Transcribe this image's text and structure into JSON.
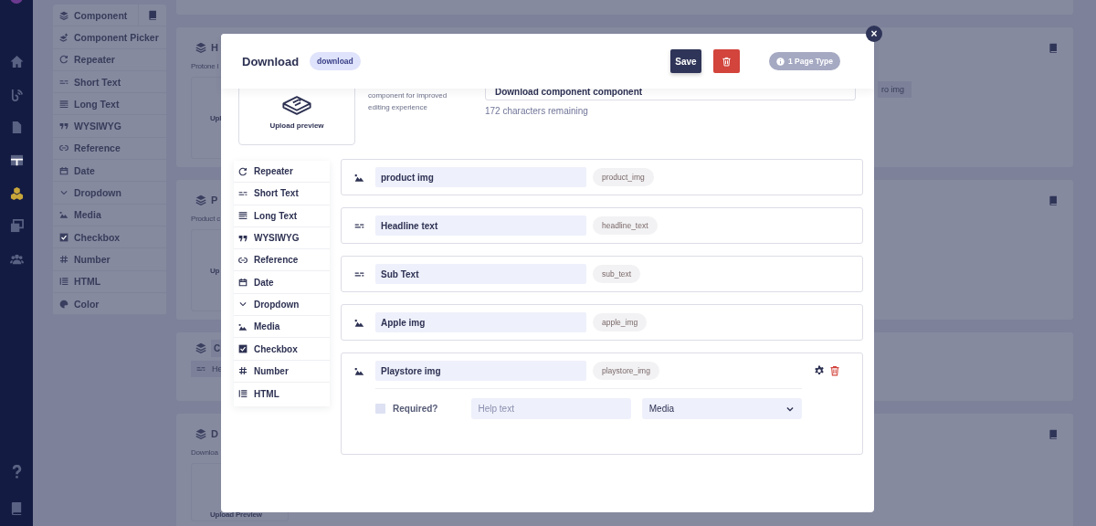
{
  "nav": [
    {
      "kind": "home",
      "selected": false
    },
    {
      "kind": "feed",
      "selected": false
    },
    {
      "kind": "document",
      "selected": false
    },
    {
      "kind": "grid",
      "selected": false
    },
    {
      "kind": "cubes",
      "selected": true
    },
    {
      "kind": "images",
      "selected": false
    },
    {
      "kind": "users",
      "selected": false
    }
  ],
  "nav_bottom": [
    {
      "kind": "help"
    },
    {
      "kind": "book"
    }
  ],
  "field_types": [
    {
      "kind": "component",
      "label": "Component",
      "docs": true
    },
    {
      "kind": "component_picker",
      "label": "Component Picker",
      "docs": false
    },
    {
      "kind": "repeater",
      "label": "Repeater",
      "docs": false
    },
    {
      "kind": "short_text",
      "label": "Short Text",
      "docs": false
    },
    {
      "kind": "long_text",
      "label": "Long Text",
      "docs": false
    },
    {
      "kind": "wysiwyg",
      "label": "WYSIWYG",
      "docs": false
    },
    {
      "kind": "reference",
      "label": "Reference",
      "docs": false
    },
    {
      "kind": "date",
      "label": "Date",
      "docs": false
    },
    {
      "kind": "dropdown",
      "label": "Dropdown",
      "docs": false
    },
    {
      "kind": "media",
      "label": "Media",
      "docs": false
    },
    {
      "kind": "checkbox",
      "label": "Checkbox",
      "docs": false
    },
    {
      "kind": "number",
      "label": "Number",
      "docs": false
    },
    {
      "kind": "html",
      "label": "HTML",
      "docs": false
    },
    {
      "kind": "color",
      "label": "Color",
      "docs": false
    }
  ],
  "cards": [
    {
      "kind": "stub"
    },
    {
      "kind": "preview",
      "title": "H",
      "description": "Protone l",
      "preview_label": "Upl",
      "docs": true,
      "chips": [
        "ro img"
      ]
    },
    {
      "kind": "preview",
      "title": "P",
      "description": "Product c",
      "preview_label": "Up",
      "docs": true
    },
    {
      "kind": "fields",
      "title": "C",
      "fields": [
        {
          "kind": "short_text",
          "label": "He"
        }
      ],
      "docs": false
    },
    {
      "kind": "preview",
      "title": "D",
      "description": "Downloa",
      "preview_label": "Upload Preview",
      "docs": true
    }
  ],
  "modal": {
    "title": "Download",
    "api_id": "download",
    "save_label": "Save",
    "page_types": "1 Page Type",
    "close_label": "×",
    "preview_label": "Upload preview",
    "preview_hint": "component for improved editing experience",
    "description_value": "Download component component",
    "chars_remaining": "172 characters remaining",
    "field_types": [
      {
        "kind": "repeater",
        "label": "Repeater"
      },
      {
        "kind": "short_text",
        "label": "Short Text"
      },
      {
        "kind": "long_text",
        "label": "Long Text"
      },
      {
        "kind": "wysiwyg",
        "label": "WYSIWYG"
      },
      {
        "kind": "reference",
        "label": "Reference"
      },
      {
        "kind": "date",
        "label": "Date"
      },
      {
        "kind": "dropdown",
        "label": "Dropdown"
      },
      {
        "kind": "media",
        "label": "Media"
      },
      {
        "kind": "checkbox",
        "label": "Checkbox"
      },
      {
        "kind": "number",
        "label": "Number"
      },
      {
        "kind": "html",
        "label": "HTML"
      }
    ],
    "fields": [
      {
        "kind": "media",
        "label": "product img",
        "api_key": "product_img",
        "expanded": false
      },
      {
        "kind": "short_text",
        "label": "Headline text",
        "api_key": "headline_text",
        "expanded": false
      },
      {
        "kind": "short_text",
        "label": "Sub Text",
        "api_key": "sub_text",
        "expanded": false
      },
      {
        "kind": "media",
        "label": "Apple img",
        "api_key": "apple_img",
        "expanded": false
      },
      {
        "kind": "media",
        "label": "Playstore img",
        "api_key": "playstore_img",
        "expanded": true,
        "required": false,
        "required_label": "Required?",
        "help_placeholder": "Help text",
        "type_value": "Media"
      }
    ]
  }
}
